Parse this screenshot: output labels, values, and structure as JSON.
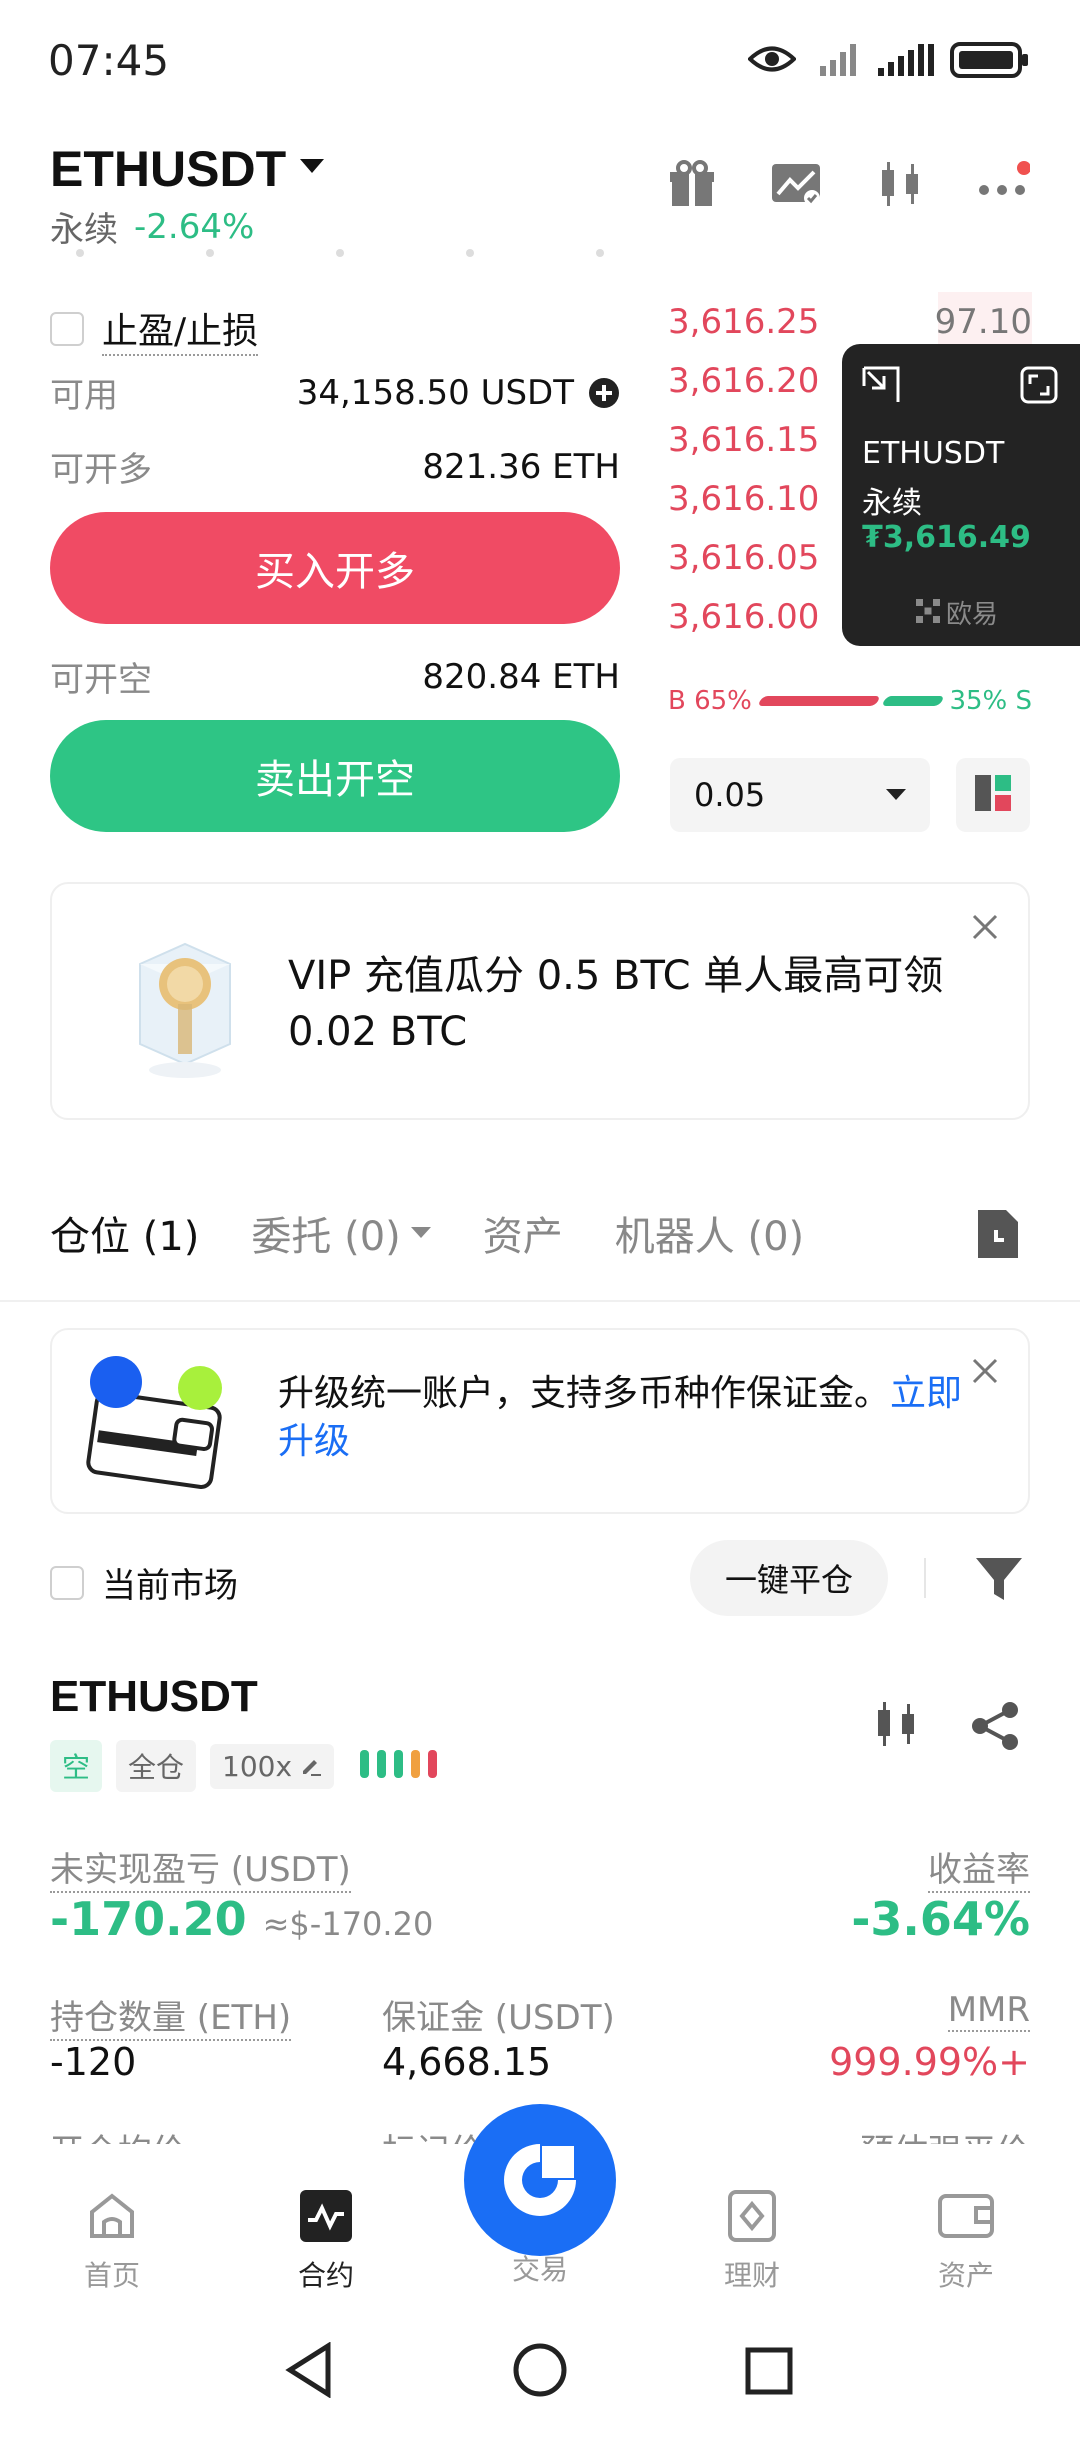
{
  "status_bar": {
    "time": "07:45"
  },
  "header": {
    "symbol": "ETHUSDT",
    "type": "永续",
    "change": "-2.64%"
  },
  "order_form": {
    "tpsl_label": "止盈/止损",
    "available_label": "可用",
    "available_value": "34,158.50 USDT",
    "can_long_label": "可开多",
    "can_long_value": "821.36 ETH",
    "buy_button": "买入开多",
    "can_short_label": "可开空",
    "can_short_value": "820.84 ETH",
    "sell_button": "卖出开空"
  },
  "order_book": {
    "asks": [
      "3,616.25",
      "3,616.20",
      "3,616.15",
      "3,616.10",
      "3,616.05",
      "3,616.00"
    ],
    "top_size": "97.10",
    "buy_ratio_label": "B 65%",
    "sell_ratio_label": "35% S",
    "buy_ratio": 0.65,
    "precision": "0.05"
  },
  "floating_window": {
    "symbol": "ETHUSDT",
    "type": "永续",
    "price": "₮3,616.49",
    "brand": "欧易"
  },
  "promo_banner": {
    "text": "VIP 充值瓜分 0.5 BTC 单人最高可领 0.02 BTC"
  },
  "tabs": [
    {
      "label": "仓位 (1)"
    },
    {
      "label": "委托 (0)"
    },
    {
      "label": "资产"
    },
    {
      "label": "机器人 (0)"
    }
  ],
  "upgrade_banner": {
    "text": "升级统一账户，支持多币种作保证金。",
    "link": "立即升级"
  },
  "filter_bar": {
    "current_market": "当前市场",
    "close_all": "一键平仓"
  },
  "position": {
    "symbol": "ETHUSDT",
    "side_tag": "空",
    "margin_tag": "全仓",
    "leverage_tag": "100x",
    "pnl_label": "未实现盈亏 (USDT)",
    "pnl_value": "-170.20",
    "pnl_usd": "≈$-170.20",
    "roe_label": "收益率",
    "roe_value": "-3.64%",
    "size_label": "持仓数量 (ETH)",
    "size_value": "-120",
    "margin_label": "保证金 (USDT)",
    "margin_value": "4,668.15",
    "mmr_label": "MMR",
    "mmr_value": "999.99%+",
    "row3_left": "开仓均价",
    "row3_mid": "标记价",
    "row3_right": "预估强平价"
  },
  "bottom_nav": [
    {
      "label": "首页",
      "icon": "home-icon"
    },
    {
      "label": "合约",
      "icon": "futures-icon"
    },
    {
      "label": "交易",
      "icon": "trade-icon"
    },
    {
      "label": "理财",
      "icon": "earn-icon"
    },
    {
      "label": "资产",
      "icon": "wallet-icon"
    }
  ],
  "colors": {
    "green": "#2dbd85",
    "red": "#e2475c",
    "buy_button": "#f04b64",
    "sell_button": "#2ec585",
    "trade_fab": "#1a6ef5"
  }
}
